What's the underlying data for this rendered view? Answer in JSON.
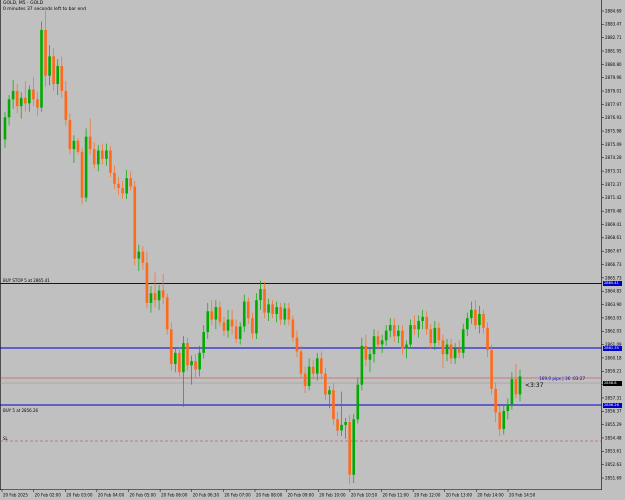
{
  "header": {
    "symbol_line": "GOLD, M5 - GOLD",
    "countdown_line": "0 minutes 37 seconds left to bar end"
  },
  "colors": {
    "background": "#c0c0c0",
    "bull": "#00aa00",
    "bear": "#ff6a1a",
    "level_line": "#0000cc",
    "bid_line": "#cc3333",
    "stop_line": "#cc3333"
  },
  "levels": {
    "buy_stop_label": "BUY STOP 5 at 2865.41",
    "buy_stop_price": "2865.41",
    "upper_line_price": "2861.35",
    "current_price": "2858.8",
    "buy_label": "BUY 5 at 2856.26",
    "buy_price": "2856.26",
    "sl_label": "SL",
    "pips_note": "169.0 pips | 36 :03:27",
    "timer_note": "<3:37"
  },
  "chart_data": {
    "type": "candlestick",
    "price_ticks": [
      "2884.69",
      "2883.47",
      "2882.71",
      "2881.95",
      "2880.80",
      "2879.96",
      "2879.01",
      "2877.97",
      "2876.93",
      "2875.98",
      "2875.09",
      "2874.28",
      "2873.31",
      "2872.37",
      "2871.42",
      "2870.48",
      "2869.41",
      "2868.61",
      "2867.67",
      "2866.73",
      "2865.73",
      "2864.83",
      "2863.90",
      "2863.03",
      "2862.03",
      "2861.09",
      "2860.18",
      "2859.21",
      "2858.25",
      "2857.31",
      "2856.37",
      "2855.29",
      "2854.48",
      "2853.61",
      "2852.63",
      "2851.69"
    ],
    "time_labels": [
      "20 Feb 2025",
      "20 Feb 02:00",
      "20 Feb 03:00",
      "20 Feb 04:00",
      "20 Feb 05:00",
      "20 Feb 06:00",
      "20 Feb 06:30",
      "20 Feb 07:00",
      "20 Feb 08:00",
      "20 Feb 09:00",
      "20 Feb 10:00",
      "20 Feb 10:50",
      "20 Feb 11:00",
      "20 Feb 12:00",
      "20 Feb 13:00",
      "20 Feb 14:00",
      "20 Feb 14:50"
    ],
    "ylim": [
      2850.7,
      2885.7
    ],
    "candles": [
      [
        2876.0,
        2878.0,
        2875.4,
        2877.6
      ],
      [
        2877.6,
        2879.2,
        2877.0,
        2878.9
      ],
      [
        2878.9,
        2880.3,
        2878.2,
        2879.5
      ],
      [
        2879.5,
        2880.0,
        2877.9,
        2878.4
      ],
      [
        2878.4,
        2879.4,
        2877.5,
        2879.0
      ],
      [
        2879.0,
        2880.2,
        2878.0,
        2878.6
      ],
      [
        2878.6,
        2879.9,
        2878.0,
        2879.6
      ],
      [
        2879.6,
        2880.5,
        2878.4,
        2878.9
      ],
      [
        2878.9,
        2879.4,
        2877.7,
        2878.3
      ],
      [
        2878.3,
        2884.5,
        2878.0,
        2883.9
      ],
      [
        2883.9,
        2885.3,
        2879.8,
        2880.6
      ],
      [
        2880.6,
        2882.8,
        2879.9,
        2882.0
      ],
      [
        2882.0,
        2882.6,
        2879.5,
        2880.0
      ],
      [
        2880.0,
        2881.8,
        2879.2,
        2881.3
      ],
      [
        2881.3,
        2882.0,
        2879.0,
        2879.5
      ],
      [
        2879.5,
        2880.2,
        2877.0,
        2877.4
      ],
      [
        2877.4,
        2877.9,
        2874.9,
        2875.3
      ],
      [
        2875.3,
        2876.3,
        2874.3,
        2875.9
      ],
      [
        2875.9,
        2876.1,
        2874.9,
        2875.1
      ],
      [
        2875.1,
        2875.4,
        2871.3,
        2871.8
      ],
      [
        2871.8,
        2876.8,
        2871.5,
        2876.2
      ],
      [
        2876.2,
        2877.5,
        2874.9,
        2875.3
      ],
      [
        2875.3,
        2875.8,
        2873.9,
        2874.2
      ],
      [
        2874.2,
        2875.6,
        2873.7,
        2875.2
      ],
      [
        2875.2,
        2875.7,
        2874.2,
        2874.6
      ],
      [
        2874.6,
        2875.7,
        2874.1,
        2875.2
      ],
      [
        2875.2,
        2875.5,
        2873.3,
        2873.6
      ],
      [
        2873.6,
        2874.1,
        2872.4,
        2872.8
      ],
      [
        2872.8,
        2873.3,
        2872.0,
        2872.5
      ],
      [
        2872.5,
        2873.0,
        2871.7,
        2872.1
      ],
      [
        2872.1,
        2873.8,
        2871.7,
        2873.2
      ],
      [
        2873.2,
        2873.7,
        2872.3,
        2872.6
      ],
      [
        2872.6,
        2873.0,
        2866.9,
        2867.4
      ],
      [
        2867.4,
        2868.4,
        2866.5,
        2867.9
      ],
      [
        2867.9,
        2868.3,
        2866.6,
        2867.1
      ],
      [
        2867.1,
        2867.9,
        2863.8,
        2864.2
      ],
      [
        2864.2,
        2865.4,
        2863.5,
        2864.9
      ],
      [
        2864.9,
        2866.4,
        2863.9,
        2864.4
      ],
      [
        2864.4,
        2865.5,
        2863.7,
        2865.1
      ],
      [
        2865.1,
        2866.3,
        2864.1,
        2864.6
      ],
      [
        2864.6,
        2864.9,
        2861.9,
        2862.3
      ],
      [
        2862.3,
        2862.8,
        2859.3,
        2859.8
      ],
      [
        2859.8,
        2861.0,
        2859.2,
        2860.6
      ],
      [
        2860.6,
        2861.0,
        2858.9,
        2859.2
      ],
      [
        2859.2,
        2861.8,
        2856.7,
        2861.3
      ],
      [
        2861.3,
        2861.7,
        2859.3,
        2859.7
      ],
      [
        2859.7,
        2860.4,
        2858.3,
        2860.0
      ],
      [
        2860.0,
        2860.5,
        2858.8,
        2859.4
      ],
      [
        2859.4,
        2861.1,
        2858.9,
        2860.6
      ],
      [
        2860.6,
        2862.6,
        2860.2,
        2862.1
      ],
      [
        2862.1,
        2864.2,
        2861.6,
        2863.6
      ],
      [
        2863.6,
        2864.4,
        2862.6,
        2863.0
      ],
      [
        2863.0,
        2864.4,
        2862.3,
        2863.9
      ],
      [
        2863.9,
        2864.3,
        2862.5,
        2862.8
      ],
      [
        2862.8,
        2863.2,
        2861.8,
        2862.2
      ],
      [
        2862.2,
        2863.7,
        2861.7,
        2863.0
      ],
      [
        2863.0,
        2863.7,
        2861.9,
        2862.5
      ],
      [
        2862.5,
        2863.0,
        2861.3,
        2861.6
      ],
      [
        2861.6,
        2862.8,
        2861.2,
        2862.5
      ],
      [
        2862.5,
        2864.8,
        2862.1,
        2864.3
      ],
      [
        2864.3,
        2864.6,
        2862.7,
        2863.1
      ],
      [
        2863.1,
        2863.5,
        2861.6,
        2862.0
      ],
      [
        2862.0,
        2864.9,
        2861.6,
        2864.4
      ],
      [
        2864.4,
        2865.8,
        2863.7,
        2865.2
      ],
      [
        2865.2,
        2865.7,
        2863.1,
        2863.5
      ],
      [
        2863.5,
        2864.5,
        2862.9,
        2864.1
      ],
      [
        2864.1,
        2864.4,
        2863.1,
        2863.4
      ],
      [
        2863.4,
        2864.3,
        2862.8,
        2863.9
      ],
      [
        2863.9,
        2864.2,
        2862.6,
        2863.0
      ],
      [
        2863.0,
        2864.2,
        2862.6,
        2863.8
      ],
      [
        2863.8,
        2864.2,
        2862.6,
        2863.0
      ],
      [
        2863.0,
        2863.3,
        2861.4,
        2861.7
      ],
      [
        2861.7,
        2862.2,
        2860.3,
        2860.7
      ],
      [
        2860.7,
        2861.1,
        2858.8,
        2859.1
      ],
      [
        2859.1,
        2859.6,
        2857.7,
        2858.2
      ],
      [
        2858.2,
        2860.2,
        2857.9,
        2859.6
      ],
      [
        2859.6,
        2860.1,
        2858.7,
        2859.1
      ],
      [
        2859.1,
        2860.6,
        2858.6,
        2860.2
      ],
      [
        2860.2,
        2860.7,
        2858.7,
        2859.1
      ],
      [
        2859.1,
        2859.5,
        2857.2,
        2857.6
      ],
      [
        2857.6,
        2858.2,
        2856.6,
        2857.9
      ],
      [
        2857.9,
        2858.4,
        2855.4,
        2855.8
      ],
      [
        2855.8,
        2856.3,
        2854.6,
        2855.0
      ],
      [
        2855.0,
        2857.8,
        2854.6,
        2855.4
      ],
      [
        2855.4,
        2855.9,
        2854.4,
        2855.6
      ],
      [
        2855.6,
        2856.1,
        2851.1,
        2851.8
      ],
      [
        2851.8,
        2856.2,
        2851.2,
        2855.8
      ],
      [
        2855.8,
        2858.8,
        2855.5,
        2858.3
      ],
      [
        2858.3,
        2861.7,
        2857.9,
        2861.1
      ],
      [
        2861.1,
        2861.9,
        2859.6,
        2860.1
      ],
      [
        2860.1,
        2860.9,
        2859.2,
        2860.5
      ],
      [
        2860.5,
        2862.3,
        2859.9,
        2861.8
      ],
      [
        2861.8,
        2862.2,
        2860.8,
        2861.2
      ],
      [
        2861.2,
        2861.9,
        2860.6,
        2861.5
      ],
      [
        2861.5,
        2862.6,
        2861.1,
        2862.2
      ],
      [
        2862.2,
        2863.1,
        2861.7,
        2862.6
      ],
      [
        2862.6,
        2863.1,
        2861.4,
        2861.8
      ],
      [
        2861.8,
        2862.6,
        2861.3,
        2862.2
      ],
      [
        2862.2,
        2862.6,
        2860.5,
        2860.9
      ],
      [
        2860.9,
        2861.5,
        2860.2,
        2861.2
      ],
      [
        2861.2,
        2863.0,
        2860.9,
        2862.6
      ],
      [
        2862.6,
        2863.3,
        2861.9,
        2862.3
      ],
      [
        2862.3,
        2863.3,
        2861.7,
        2862.9
      ],
      [
        2862.9,
        2863.7,
        2862.3,
        2863.2
      ],
      [
        2863.2,
        2863.6,
        2861.9,
        2862.3
      ],
      [
        2862.3,
        2862.7,
        2860.9,
        2861.3
      ],
      [
        2861.3,
        2862.9,
        2860.8,
        2862.4
      ],
      [
        2862.4,
        2862.8,
        2861.1,
        2861.5
      ],
      [
        2861.5,
        2861.9,
        2859.5,
        2860.5
      ],
      [
        2860.5,
        2861.6,
        2860.0,
        2861.2
      ],
      [
        2861.2,
        2861.6,
        2859.8,
        2860.2
      ],
      [
        2860.2,
        2861.3,
        2859.8,
        2860.9
      ],
      [
        2860.9,
        2861.5,
        2860.2,
        2860.6
      ],
      [
        2860.6,
        2862.7,
        2860.2,
        2862.3
      ],
      [
        2862.3,
        2863.5,
        2861.8,
        2863.1
      ],
      [
        2863.1,
        2864.3,
        2862.7,
        2863.7
      ],
      [
        2863.7,
        2864.4,
        2862.3,
        2862.6
      ],
      [
        2862.6,
        2864.0,
        2862.0,
        2863.4
      ],
      [
        2863.4,
        2863.7,
        2862.0,
        2862.4
      ],
      [
        2862.4,
        2862.8,
        2860.3,
        2860.8
      ],
      [
        2860.8,
        2861.2,
        2857.6,
        2858.0
      ],
      [
        2858.0,
        2858.4,
        2855.6,
        2856.3
      ],
      [
        2856.3,
        2856.8,
        2854.6,
        2855.1
      ],
      [
        2855.1,
        2856.9,
        2854.7,
        2856.4
      ],
      [
        2856.4,
        2857.3,
        2855.8,
        2856.9
      ],
      [
        2856.9,
        2859.2,
        2856.5,
        2858.7
      ],
      [
        2858.7,
        2859.8,
        2857.3,
        2857.6
      ],
      [
        2857.6,
        2859.4,
        2857.1,
        2858.9
      ]
    ]
  }
}
